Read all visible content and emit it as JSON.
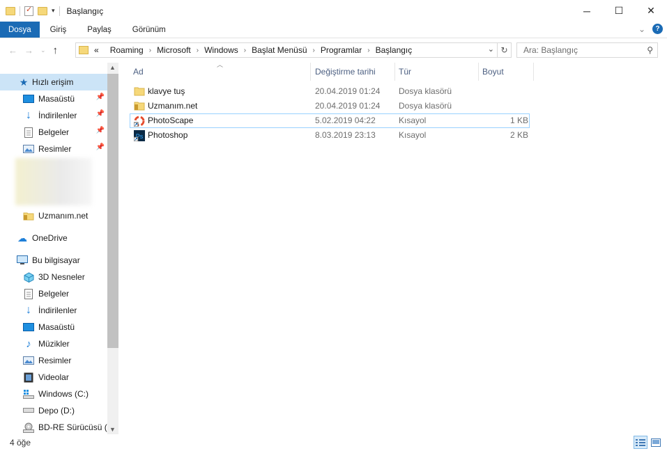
{
  "window": {
    "title": "Başlangıç"
  },
  "ribbon": {
    "tabs": [
      "Dosya",
      "Giriş",
      "Paylaş",
      "Görünüm"
    ],
    "help": "?"
  },
  "address": {
    "overflow": "«",
    "crumbs": [
      "Roaming",
      "Microsoft",
      "Windows",
      "Başlat Menüsü",
      "Programlar",
      "Başlangıç"
    ]
  },
  "search": {
    "placeholder": "Ara: Başlangıç"
  },
  "nav": {
    "quick_access": "Hızlı erişim",
    "quick_items": [
      "Masaüstü",
      "İndirilenler",
      "Belgeler",
      "Resimler"
    ],
    "uzmanim": "Uzmanım.net",
    "onedrive": "OneDrive",
    "this_pc": "Bu bilgisayar",
    "pc_items": [
      "3D Nesneler",
      "Belgeler",
      "İndirilenler",
      "Masaüstü",
      "Müzikler",
      "Resimler",
      "Videolar",
      "Windows (C:)",
      "Depo  (D:)",
      "BD-RE Sürücüsü (E"
    ]
  },
  "columns": {
    "name": "Ad",
    "modified": "Değiştirme tarihi",
    "type": "Tür",
    "size": "Boyut"
  },
  "files": [
    {
      "name": "klavye tuş",
      "modified": "20.04.2019 01:24",
      "type": "Dosya klasörü",
      "size": ""
    },
    {
      "name": "Uzmanım.net",
      "modified": "20.04.2019 01:24",
      "type": "Dosya klasörü",
      "size": ""
    },
    {
      "name": "PhotoScape",
      "modified": "5.02.2019 04:22",
      "type": "Kısayol",
      "size": "1 KB"
    },
    {
      "name": "Photoshop",
      "modified": "8.03.2019 23:13",
      "type": "Kısayol",
      "size": "2 KB"
    }
  ],
  "status": {
    "count": "4 öğe"
  },
  "colors": {
    "accent": "#1b6bb5",
    "selection": "#cce4f7",
    "header_text": "#4d6082"
  }
}
